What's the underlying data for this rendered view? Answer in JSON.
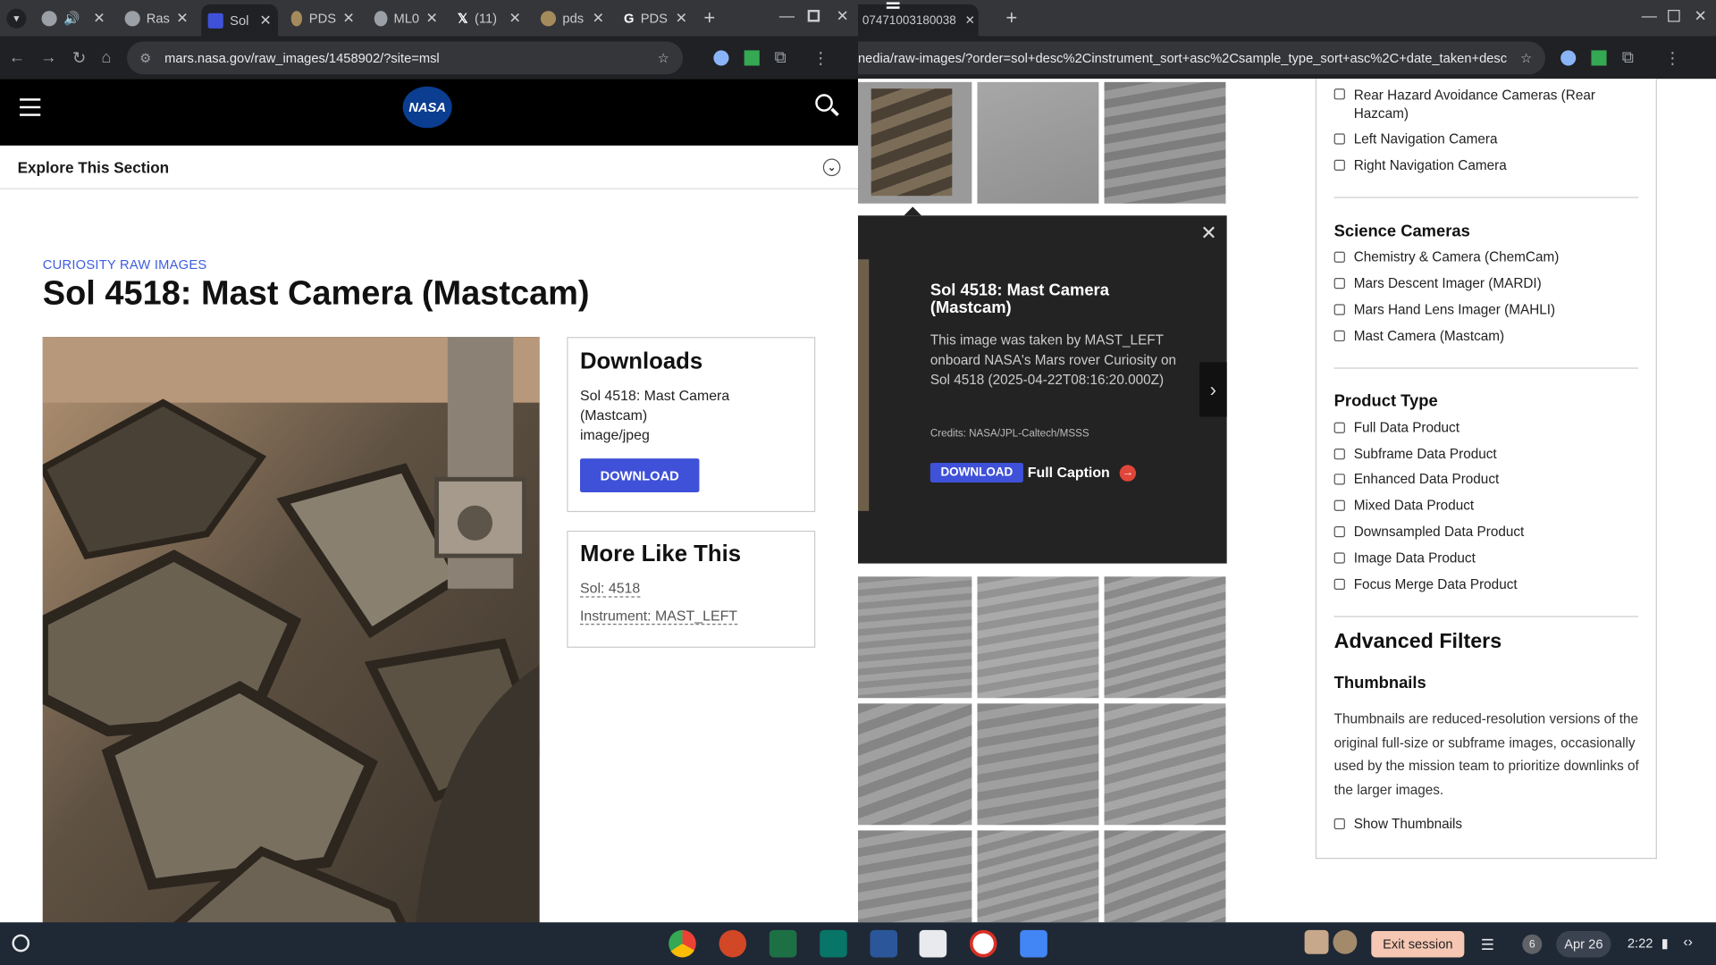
{
  "left_tabs": [
    {
      "label": "Ras"
    },
    {
      "label": "Sol"
    },
    {
      "label": "PDS"
    },
    {
      "label": "ML0"
    },
    {
      "label": "(11)"
    },
    {
      "label": "pds"
    },
    {
      "label": "PDS"
    }
  ],
  "left_url": "mars.nasa.gov/raw_images/1458902/?site=msl",
  "right_tab": "07471003180038",
  "right_url": "nedia/raw-images/?order=sol+desc%2Cinstrument_sort+asc%2Csample_type_sort+asc%2C+date_taken+desc&per_pa...",
  "nasa": {
    "logo": "NASA"
  },
  "explore": "Explore This Section",
  "breadcrumb": "CURIOSITY RAW IMAGES",
  "page_title": "Sol 4518: Mast Camera (Mastcam)",
  "downloads": {
    "heading": "Downloads",
    "file_title": "Sol 4518: Mast Camera (Mastcam)",
    "file_type": "image/jpeg",
    "button": "DOWNLOAD"
  },
  "more_like": {
    "heading": "More Like This",
    "sol_link": "Sol: 4518",
    "instrument_link": "Instrument: MAST_LEFT"
  },
  "popup": {
    "title": "Sol 4518: Mast Camera (Mastcam)",
    "description": "This image was taken by MAST_LEFT onboard NASA's Mars rover Curiosity on Sol 4518 (2025-04-22T08:16:20.000Z)",
    "credits": "Credits: NASA/JPL-Caltech/MSSS",
    "download": "DOWNLOAD",
    "full_caption": "Full Caption"
  },
  "filters": {
    "engineering": [
      "Rear Hazard Avoidance Cameras (Rear Hazcam)",
      "Left Navigation Camera",
      "Right Navigation Camera"
    ],
    "science_heading": "Science Cameras",
    "science": [
      "Chemistry & Camera (ChemCam)",
      "Mars Descent Imager (MARDI)",
      "Mars Hand Lens Imager (MAHLI)",
      "Mast Camera (Mastcam)"
    ],
    "product_heading": "Product Type",
    "product": [
      "Full Data Product",
      "Subframe Data Product",
      "Enhanced Data Product",
      "Mixed Data Product",
      "Downsampled Data Product",
      "Image Data Product",
      "Focus Merge Data Product"
    ],
    "advanced_heading": "Advanced Filters",
    "thumbnails_heading": "Thumbnails",
    "thumbnails_text": "Thumbnails are reduced-resolution versions of the original full-size or subframe images, occasionally used by the mission team to prioritize downlinks of the larger images.",
    "show_thumbnails": "Show Thumbnails"
  },
  "taskbar": {
    "exit": "Exit session",
    "notif_count": "6",
    "date": "Apr 26",
    "time": "2:22"
  },
  "colors": {
    "accent": "#3f51d8",
    "chrome": "#35363a",
    "taskbar": "#1f2835"
  }
}
